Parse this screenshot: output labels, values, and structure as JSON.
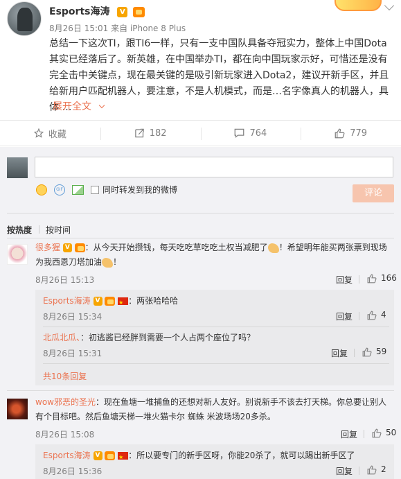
{
  "post": {
    "author": "Esports海涛",
    "meta": "8月26日 15:01 来自 iPhone 8 Plus",
    "content": "总结一下这次TI，跟TI6一样，只有一支中国队具备夺冠实力，整体上中国Dota其实已经落后了。新英雄，在中国举办TI，都在向中国玩家示好，可惜还是没有完全击中关键点，现在最关键的是吸引新玩家进入Dota2，建议开新手区，并且给新用户匹配机器人，要注意，不是人机模式，而是…名字像真人的机器人，具体 …",
    "expand_label": "展开全文"
  },
  "actions": {
    "favorite": "收藏",
    "repost_count": "182",
    "comment_count": "764",
    "like_count": "779"
  },
  "composer": {
    "repost_label": "同时转发到我的微博",
    "submit_label": "评论"
  },
  "sort": {
    "hot": "按热度",
    "time": "按时间"
  },
  "comments": [
    {
      "name": "很多猩",
      "text": "：从今天开始攒钱，每天吃吃草吃吃土权当减肥了",
      "text2": "！希望明年能买两张票到现场为我西恩刀塔加油",
      "text3": "！",
      "time": "8月26日 15:13",
      "reply": "回复",
      "likes": "166",
      "replies": [
        {
          "name": "Esports海涛",
          "text": "：两张哈哈哈",
          "time": "8月26日 15:34",
          "reply": "回复",
          "likes": "4"
        },
        {
          "name": "北瓜北瓜、",
          "text": "：初逃酱已经胖到需要一个人占两个座位了吗？",
          "time": "8月26日 15:31",
          "reply": "回复",
          "likes": "59"
        }
      ],
      "more": "共10条回复"
    },
    {
      "name": "wow邪恶的圣光",
      "text": "：现在鱼塘一堆捕鱼的还想对新人友好。别说新手不该去打天梯。你总要让别人有个目标吧。然后鱼塘天梯一堆火猫卡尔 蜘蛛 米波场场20多杀。",
      "time": "8月26日 15:08",
      "reply": "回复",
      "likes": "50",
      "replies": [
        {
          "name": "Esports海涛",
          "text": "：所以要专门的新手区呀，你能20杀了，就可以踢出新手区了",
          "time": "8月26日 15:36",
          "reply": "回复",
          "likes": "2"
        }
      ]
    }
  ],
  "colors": {
    "accent": "#eb7350",
    "submit_disabled": "#f7c5ae",
    "comment_bg": "#f2f2f5"
  }
}
